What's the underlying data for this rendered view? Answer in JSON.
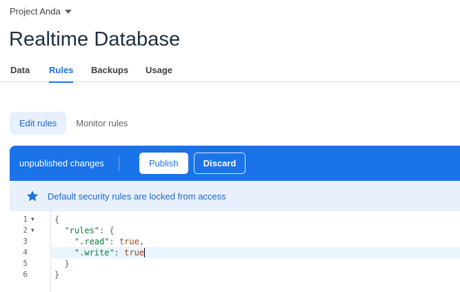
{
  "project": {
    "name": "Project Anda"
  },
  "page": {
    "title": "Realtime Database"
  },
  "tabs": [
    {
      "label": "Data",
      "active": false
    },
    {
      "label": "Rules",
      "active": true
    },
    {
      "label": "Backups",
      "active": false
    },
    {
      "label": "Usage",
      "active": false
    }
  ],
  "subtabs": [
    {
      "label": "Edit rules",
      "active": true
    },
    {
      "label": "Monitor rules",
      "active": false
    }
  ],
  "editor_bar": {
    "status": "unpublished changes",
    "publish_label": "Publish",
    "discard_label": "Discard"
  },
  "notice": {
    "icon": "star-icon",
    "text": "Default security rules are locked from access"
  },
  "code": {
    "line_numbers": [
      "1",
      "2",
      "3",
      "4",
      "5",
      "6"
    ],
    "l1": "{",
    "l2_key": "\"rules\"",
    "l2_rest": ": {",
    "l3_key": "\".read\"",
    "l3_colon": ": ",
    "l3_val": "true",
    "l3_comma": ",",
    "l4_key": "\".write\"",
    "l4_colon": ": ",
    "l4_val": "true",
    "l5": "}",
    "l6": "}"
  },
  "colors": {
    "accent": "#1a73e8",
    "notice_bg": "#e8f0fe",
    "json_key": "#0b7a3b",
    "json_value": "#a0421d"
  }
}
